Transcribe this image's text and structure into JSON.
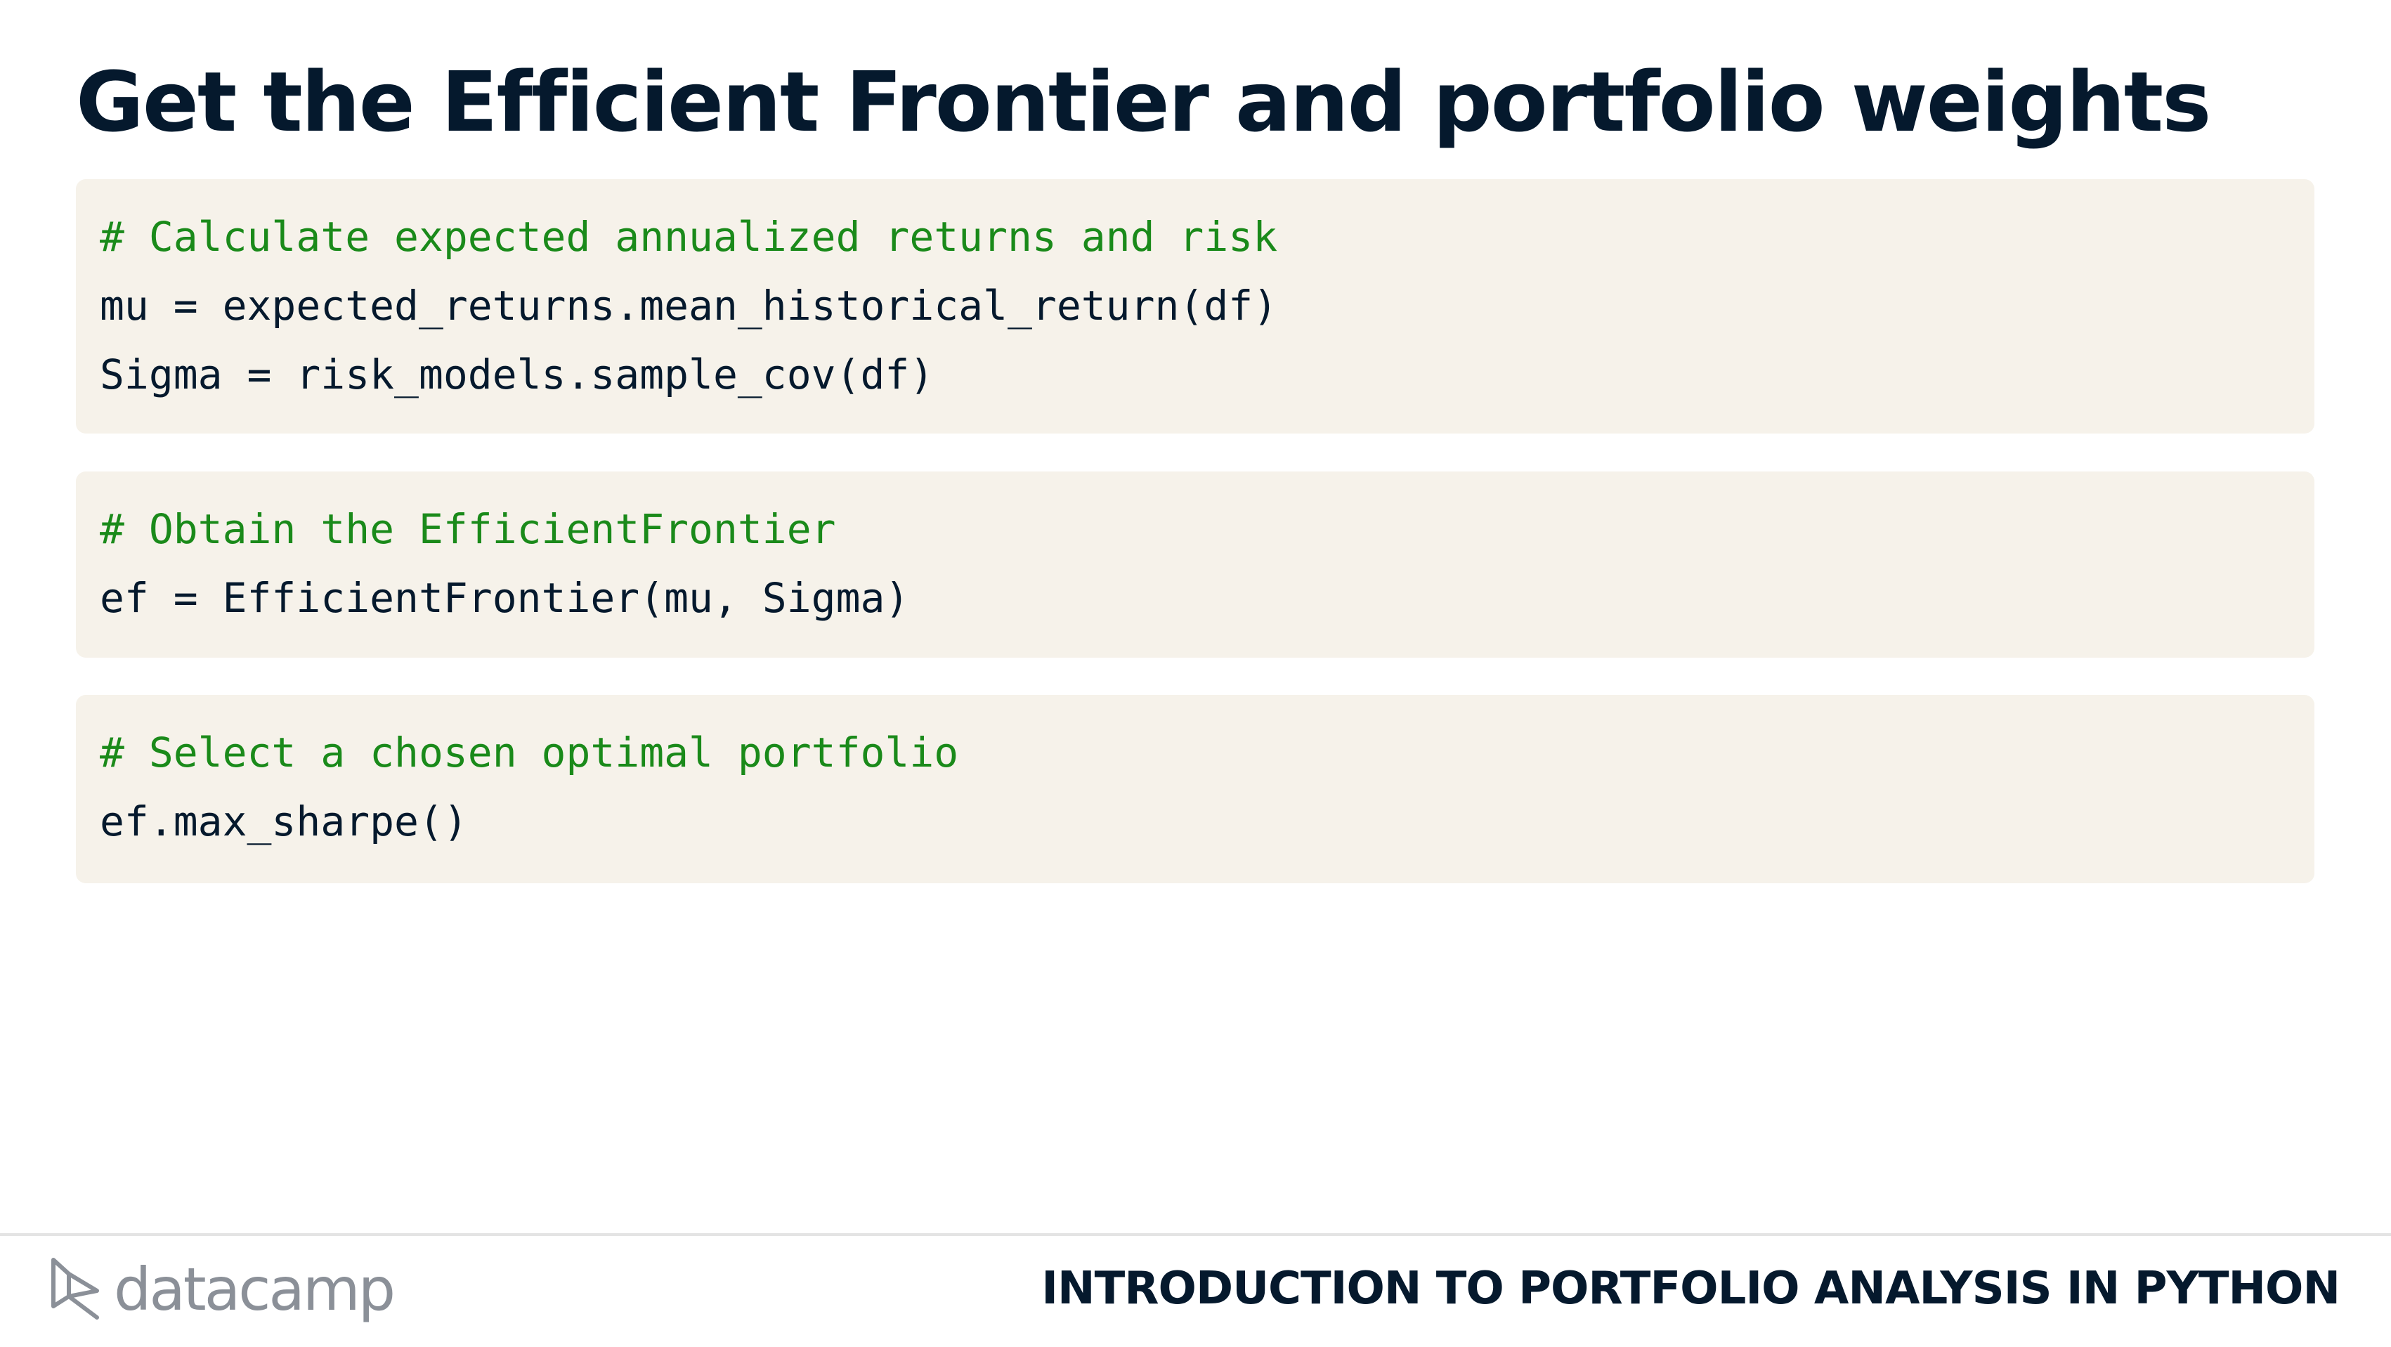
{
  "slide": {
    "title": "Get the Efficient Frontier and portfolio weights"
  },
  "code_blocks": [
    {
      "lines": [
        {
          "text": "# Calculate expected annualized returns and risk",
          "kind": "comment"
        },
        {
          "text": "mu = expected_returns.mean_historical_return(df)",
          "kind": "code"
        },
        {
          "text": "Sigma = risk_models.sample_cov(df)",
          "kind": "code"
        }
      ]
    },
    {
      "lines": [
        {
          "text": "# Obtain the EfficientFrontier",
          "kind": "comment"
        },
        {
          "text": "ef = EfficientFrontier(mu, Sigma)",
          "kind": "code"
        }
      ]
    },
    {
      "lines": [
        {
          "text": "# Select a chosen optimal portfolio",
          "kind": "comment"
        },
        {
          "text": "ef.max_sharpe()",
          "kind": "code"
        }
      ]
    }
  ],
  "footer": {
    "brand": "datacamp",
    "brand_icon": "datacamp-logo-icon",
    "course_title": "INTRODUCTION TO PORTFOLIO ANALYSIS IN PYTHON"
  },
  "colors": {
    "title": "#05192d",
    "code_background": "#f6f2ea",
    "comment": "#1a8a1a",
    "code_text": "#05192d",
    "brand_grey": "#8b9098"
  }
}
